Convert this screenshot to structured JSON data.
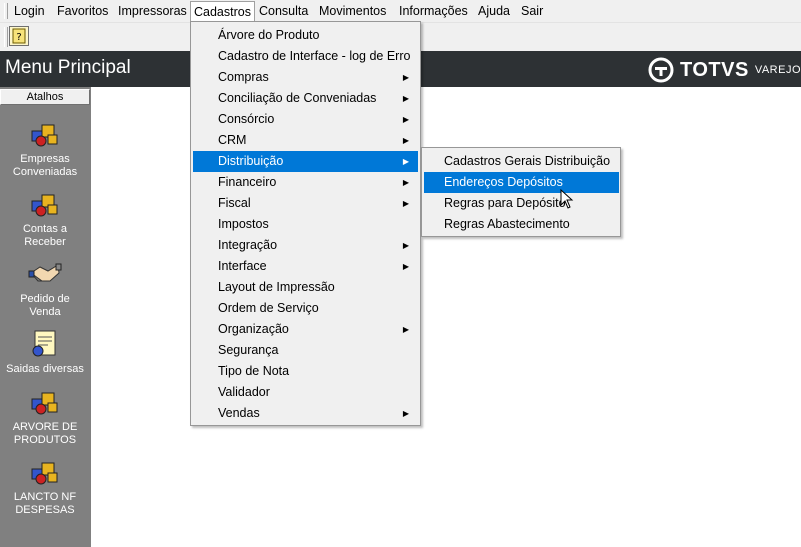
{
  "menubar": {
    "items": [
      {
        "label": "Login"
      },
      {
        "label": "Favoritos"
      },
      {
        "label": "Impressoras"
      },
      {
        "label": "Cadastros"
      },
      {
        "label": "Consulta"
      },
      {
        "label": "Movimentos"
      },
      {
        "label": "Informações"
      },
      {
        "label": "Ajuda"
      },
      {
        "label": "Sair"
      }
    ],
    "active": "Cadastros"
  },
  "toolbar": {
    "button_icon": "glossary-icon"
  },
  "header": {
    "title": "Menu Principal",
    "logo_brand": "TOTVS",
    "logo_sub": "VAREJO",
    "background": "#2d3134"
  },
  "sidebar": {
    "tab_label": "Atalhos",
    "shortcuts": [
      {
        "label1": "Empresas",
        "label2": "Conveniadas",
        "icon": "blocks-icon"
      },
      {
        "label1": "Contas a",
        "label2": "Receber",
        "icon": "blocks-icon"
      },
      {
        "label1": "Pedido de",
        "label2": "Venda",
        "icon": "handshake-icon"
      },
      {
        "label1": "Saidas diversas",
        "label2": "",
        "icon": "document-icon"
      },
      {
        "label1": "ARVORE DE",
        "label2": "PRODUTOS",
        "icon": "blocks-icon"
      },
      {
        "label1": "LANCTO NF",
        "label2": "DESPESAS",
        "icon": "blocks-icon"
      }
    ]
  },
  "cadastros_menu": {
    "items": [
      {
        "label": "Árvore do Produto",
        "submenu": false
      },
      {
        "label": "Cadastro de Interface - log de Erro",
        "submenu": false
      },
      {
        "label": "Compras",
        "submenu": true
      },
      {
        "label": "Conciliação de Conveniadas",
        "submenu": true
      },
      {
        "label": "Consórcio",
        "submenu": true
      },
      {
        "label": "CRM",
        "submenu": true
      },
      {
        "label": "Distribuição",
        "submenu": true
      },
      {
        "label": "Financeiro",
        "submenu": true
      },
      {
        "label": "Fiscal",
        "submenu": true
      },
      {
        "label": "Impostos",
        "submenu": false
      },
      {
        "label": "Integração",
        "submenu": true
      },
      {
        "label": "Interface",
        "submenu": true
      },
      {
        "label": "Layout de Impressão",
        "submenu": false
      },
      {
        "label": "Ordem de Serviço",
        "submenu": false
      },
      {
        "label": "Organização",
        "submenu": true
      },
      {
        "label": "Segurança",
        "submenu": false
      },
      {
        "label": "Tipo de Nota",
        "submenu": false
      },
      {
        "label": "Validador",
        "submenu": false
      },
      {
        "label": "Vendas",
        "submenu": true
      }
    ],
    "highlighted": "Distribuição"
  },
  "distribuicao_submenu": {
    "items": [
      {
        "label": "Cadastros Gerais Distribuição"
      },
      {
        "label": "Endereços Depósitos"
      },
      {
        "label": "Regras para Depósito"
      },
      {
        "label": "Regras Abastecimento"
      }
    ],
    "highlighted": "Endereços Depósitos"
  },
  "colors": {
    "highlight": "#0078d7",
    "sidebar": "#808080",
    "menubar": "#f0f0f0"
  }
}
